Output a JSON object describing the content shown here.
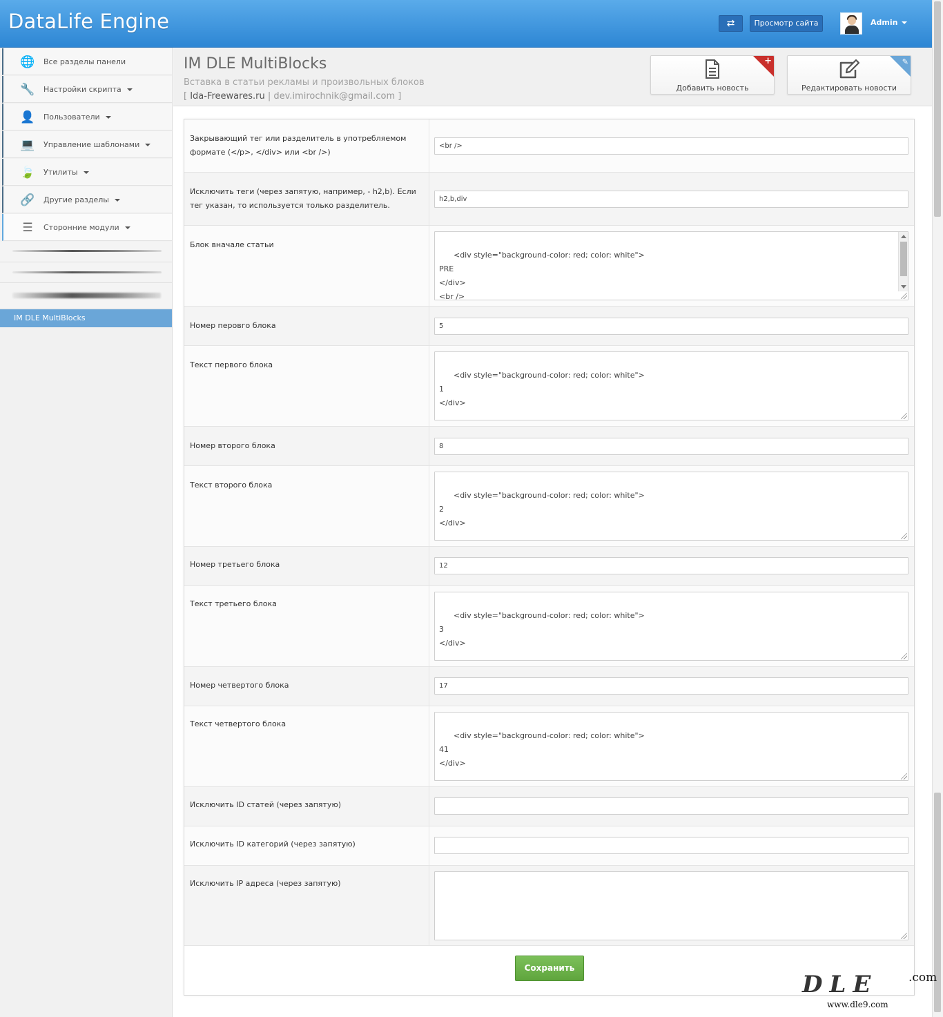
{
  "header": {
    "brand": "DataLife Engine",
    "swap_icon": "⇄",
    "view_site": "Просмотр сайта",
    "user": "Admin"
  },
  "sidebar": {
    "items": [
      {
        "label": "Все разделы панели",
        "icon": "globe-icon",
        "glyph": "🌐",
        "caret": false
      },
      {
        "label": "Настройки скрипта",
        "icon": "wrench-icon",
        "glyph": "🔧",
        "caret": true
      },
      {
        "label": "Пользователи",
        "icon": "user-icon",
        "glyph": "👤",
        "caret": true
      },
      {
        "label": "Управление шаблонами",
        "icon": "laptop-icon",
        "glyph": "💻",
        "caret": true
      },
      {
        "label": "Утилиты",
        "icon": "leaf-icon",
        "glyph": "🍃",
        "caret": true
      },
      {
        "label": "Другие разделы",
        "icon": "link-icon",
        "glyph": "🔗",
        "caret": true
      },
      {
        "label": "Сторонние модули",
        "icon": "list-icon",
        "glyph": "☰",
        "caret": true
      }
    ],
    "active_item": "IM DLE MultiBlocks"
  },
  "page": {
    "title": "IM DLE MultiBlocks",
    "subtitle": "Вставка в статьи рекламы и произвольных блоков",
    "bracket_open": "[",
    "site": "Ida-Freewares.ru",
    "separator": "|",
    "email": "dev.imirochnik@gmail.com",
    "bracket_close": "]"
  },
  "quick_buttons": {
    "add_news": "Добавить новость",
    "edit_news": "Редактировать новости"
  },
  "form": {
    "closing_tag_label": "Закрывающий тег или разделитель в употребляемом формате (</p>, </div> или <br />)",
    "closing_tag_value": "<br />",
    "exclude_tags_label": "Исключить теги (через запятую, например, - h2,b). Если тег указан, то используется только разделитель.",
    "exclude_tags_value": "h2,b,div",
    "start_block_label": "Блок вначале статьи",
    "start_block_value": "<div style=\"background-color: red; color: white\">\nPRE\n</div>\n<br />",
    "first_num_label": "Номер перовго блока",
    "first_num_value": "5",
    "first_text_label": "Текст первого блока",
    "first_text_value": "<div style=\"background-color: red; color: white\">\n1\n</div>",
    "second_num_label": "Номер второго блока",
    "second_num_value": "8",
    "second_text_label": "Текст второго блока",
    "second_text_value": "<div style=\"background-color: red; color: white\">\n2\n</div>",
    "third_num_label": "Номер третьего блока",
    "third_num_value": "12",
    "third_text_label": "Текст третьего блока",
    "third_text_value": "<div style=\"background-color: red; color: white\">\n3\n</div>",
    "fourth_num_label": "Номер четвертого блока",
    "fourth_num_value": "17",
    "fourth_text_label": "Текст четвертого блока",
    "fourth_text_value": "<div style=\"background-color: red; color: white\">\n41\n</div>",
    "exclude_ids_label": "Исключить ID статей (через запятую)",
    "exclude_ids_value": "",
    "exclude_cats_label": "Исключить ID категорий (через запятую)",
    "exclude_cats_value": "",
    "exclude_ips_label": "Исключить IP адреса (через запятую)",
    "exclude_ips_value": "",
    "save": "Сохранить"
  },
  "watermark": {
    "com": ".com",
    "big": "DLE",
    "url": "www.dle9.com"
  },
  "colors": {
    "header": "#3b95df",
    "active_item": "#6aa6d8",
    "save_button": "#6cb24a",
    "add_corner": "#c9302c",
    "edit_corner": "#6aa6d8"
  }
}
